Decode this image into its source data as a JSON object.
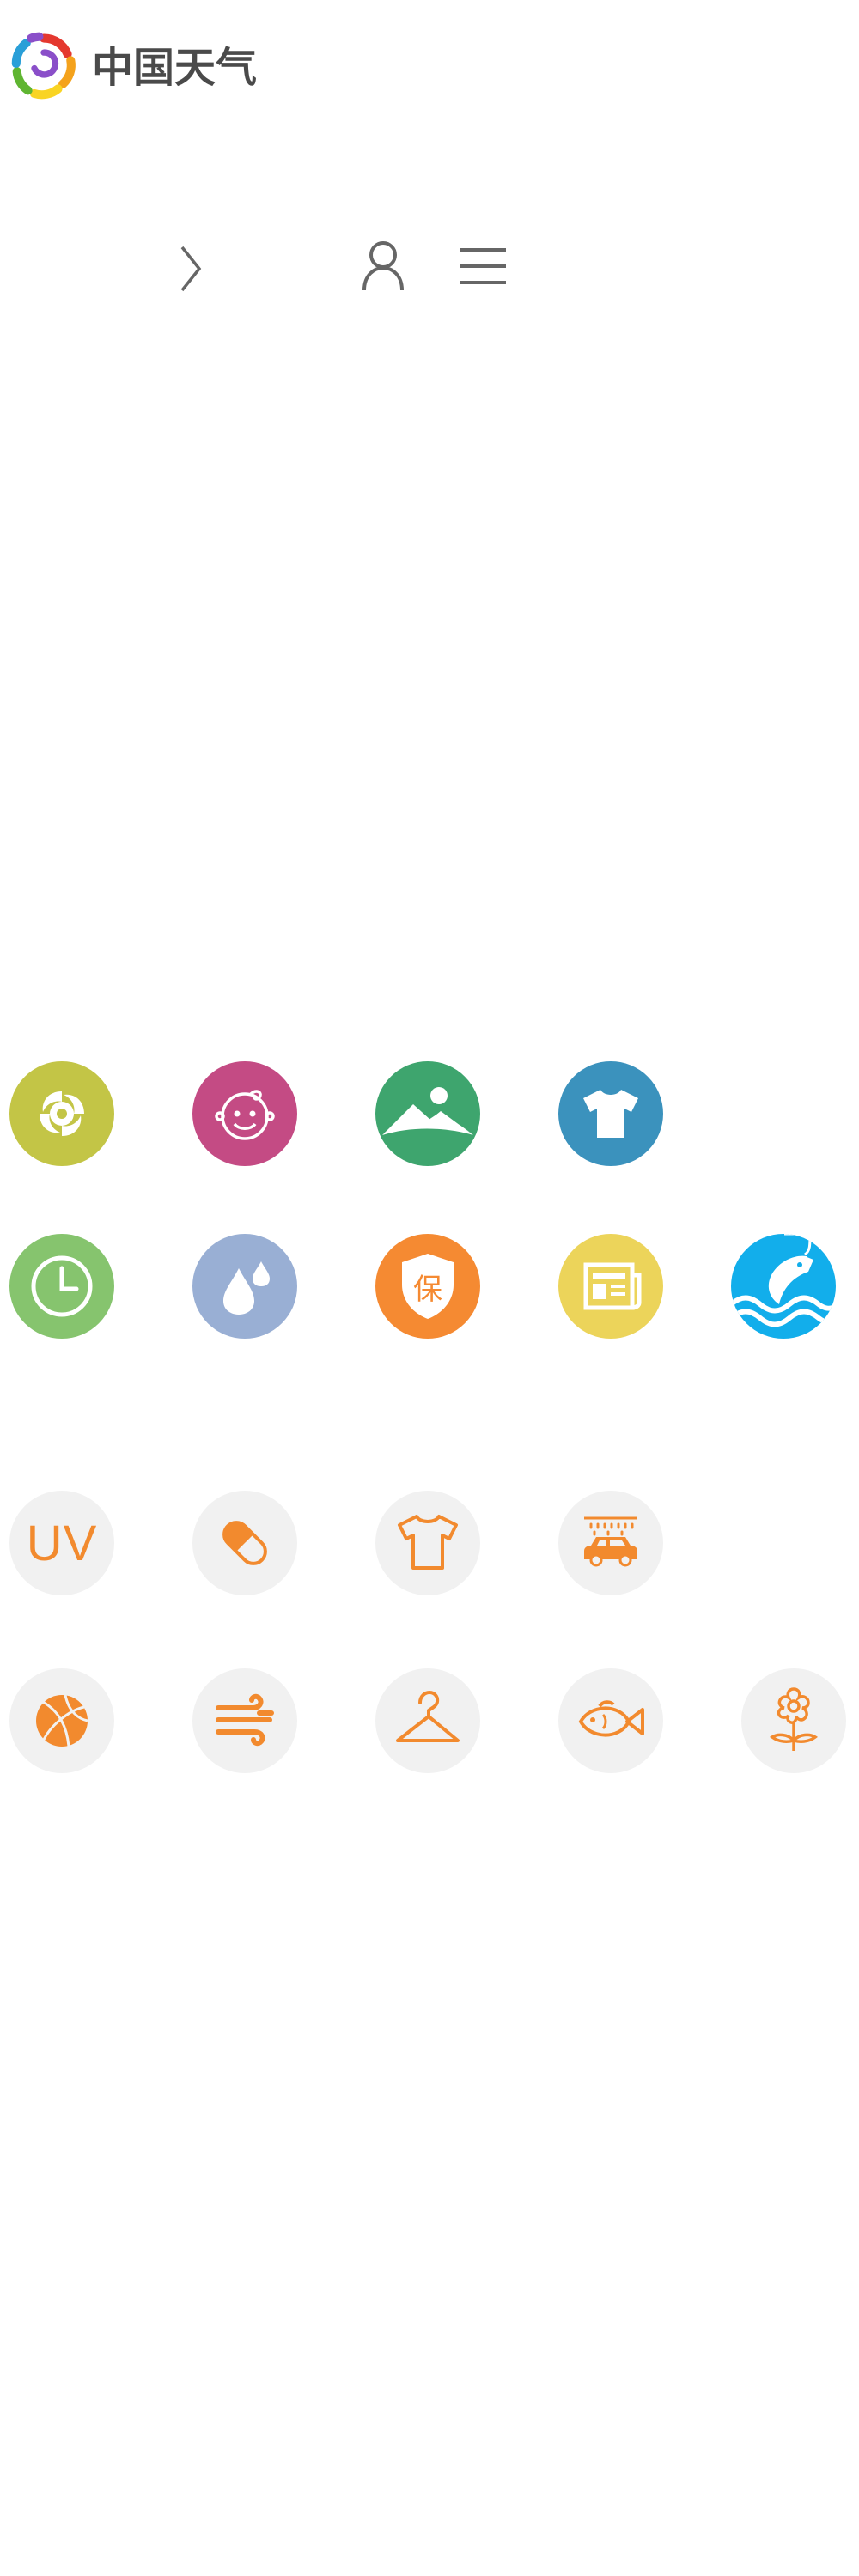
{
  "logo": {
    "text": "中国天气",
    "colors": [
      "#e4382f",
      "#f4a21c",
      "#f9d423",
      "#5fb531",
      "#2a9fd8",
      "#8a4fc9"
    ]
  },
  "header": {
    "chevron_icon": "chevron-right-icon",
    "user_icon": "user-icon",
    "menu_icon": "hamburger-menu-icon",
    "icon_color": "#666666"
  },
  "service_icons": {
    "row1": [
      {
        "icon": "typhoon-icon",
        "color": "#c3c546"
      },
      {
        "icon": "baby-face-icon",
        "color": "#c44b84"
      },
      {
        "icon": "landscape-icon",
        "color": "#3ea56e"
      },
      {
        "icon": "tshirt-icon",
        "color": "#3b92bd"
      }
    ],
    "row2": [
      {
        "icon": "clock-icon",
        "color": "#86c46e"
      },
      {
        "icon": "water-drops-icon",
        "color": "#99afd4"
      },
      {
        "icon": "insurance-shield-icon",
        "color": "#f58a32",
        "label": "保"
      },
      {
        "icon": "newspaper-icon",
        "color": "#ecd45a"
      },
      {
        "icon": "fishing-icon",
        "color": "#12aeeb"
      }
    ]
  },
  "index_icons": {
    "color": "#f28a2e",
    "background": "#f1f1f1",
    "row1": [
      {
        "icon": "uv-icon",
        "label": "UV"
      },
      {
        "icon": "pill-icon"
      },
      {
        "icon": "tshirt-outline-icon"
      },
      {
        "icon": "car-wash-icon"
      }
    ],
    "row2": [
      {
        "icon": "basketball-icon"
      },
      {
        "icon": "wind-icon"
      },
      {
        "icon": "hanger-icon"
      },
      {
        "icon": "fish-icon"
      },
      {
        "icon": "flower-icon"
      }
    ]
  }
}
